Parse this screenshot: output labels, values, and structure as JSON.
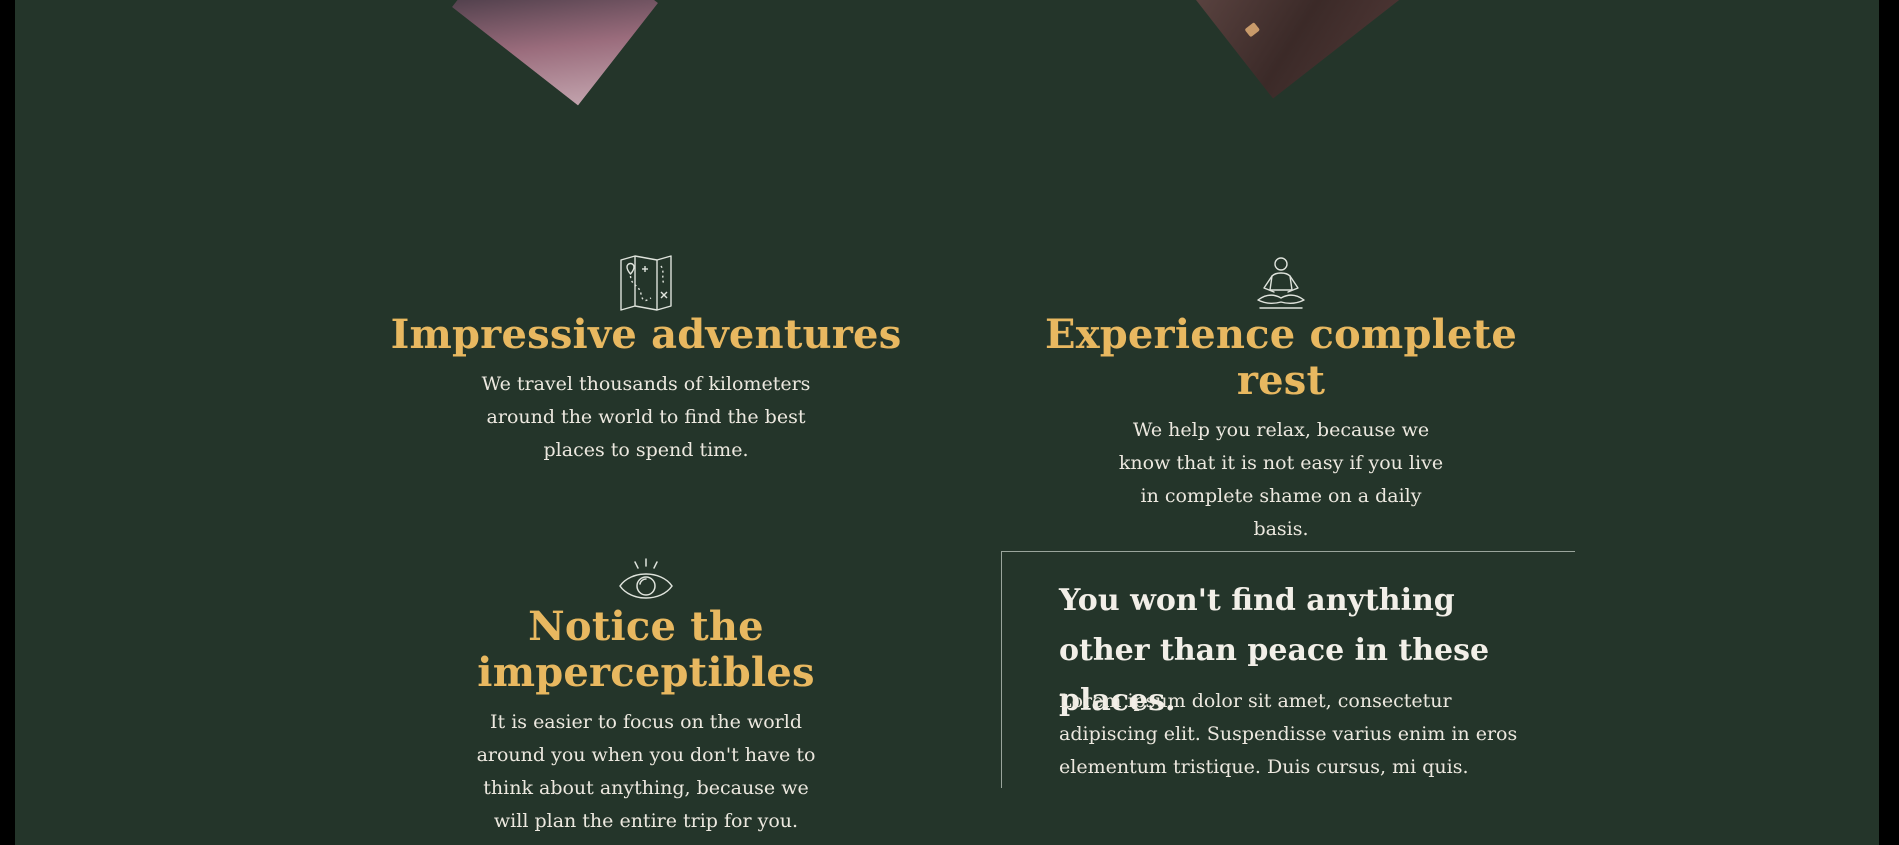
{
  "features": [
    {
      "icon": "treasure-map-icon",
      "title": "Impressive adventures",
      "text": "We travel thousands of kilometers around the world to find the best places to spend time."
    },
    {
      "icon": "meditation-icon",
      "title": "Experience complete rest",
      "text": "We help you relax, because we know that it is not easy if you live in complete shame on a daily basis."
    },
    {
      "icon": "eye-icon",
      "title": "Notice the imperceptibles",
      "text": "It is easier to focus on the world around you when you don't have to think about anything, because we will plan the entire trip for you."
    }
  ],
  "quote": {
    "heading": "You won't find anything other than peace in these places.",
    "body": "Lorem ipsum dolor sit amet, consectetur adipiscing elit. Suspendisse varius enim in eros elementum tristique. Duis cursus, mi quis."
  },
  "colors": {
    "background": "#24352a",
    "accent": "#e8b860",
    "text": "#ece8df",
    "outer": "#000000"
  }
}
